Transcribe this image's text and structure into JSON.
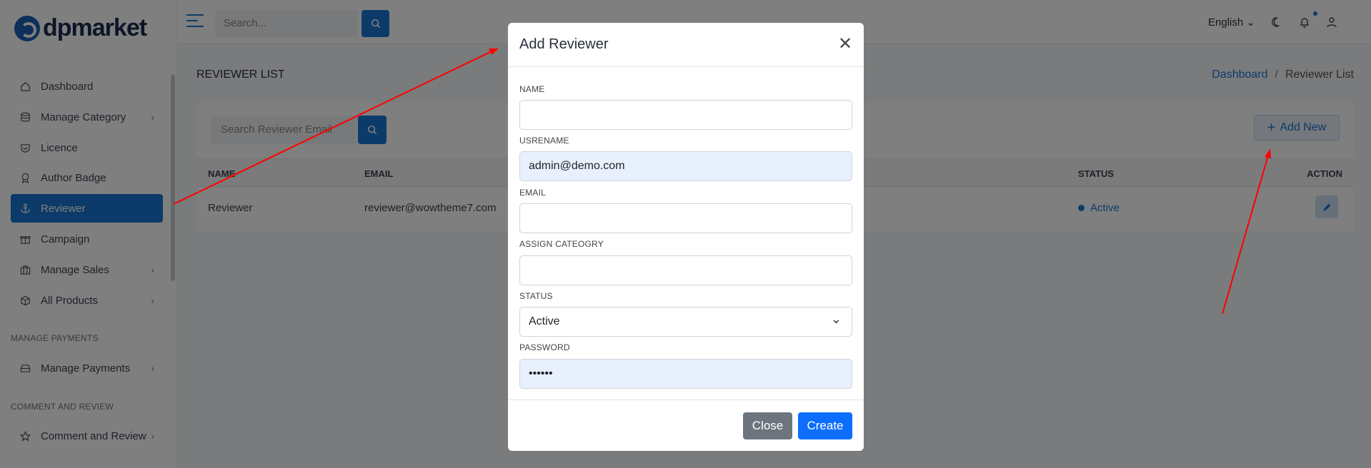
{
  "app": {
    "logo_text": "dpmarket"
  },
  "sidebar": {
    "items": [
      {
        "label": "Dashboard",
        "icon": "home-icon"
      },
      {
        "label": "Manage Category",
        "icon": "database-icon",
        "chevron": true
      },
      {
        "label": "Licence",
        "icon": "shield-icon"
      },
      {
        "label": "Author Badge",
        "icon": "award-icon"
      },
      {
        "label": "Reviewer",
        "icon": "anchor-icon",
        "active": true
      },
      {
        "label": "Campaign",
        "icon": "gift-icon"
      },
      {
        "label": "Manage Sales",
        "icon": "briefcase-icon",
        "chevron": true
      },
      {
        "label": "All Products",
        "icon": "box-icon",
        "chevron": true
      }
    ],
    "sections": [
      {
        "title": "MANAGE PAYMENTS",
        "items": [
          {
            "label": "Manage Payments",
            "icon": "card-icon",
            "chevron": true
          }
        ]
      },
      {
        "title": "COMMENT AND REVIEW",
        "items": [
          {
            "label": "Comment and Review",
            "icon": "star-icon",
            "chevron": true
          }
        ]
      }
    ]
  },
  "topbar": {
    "search_placeholder": "Search...",
    "language": "English"
  },
  "page": {
    "title": "REVIEWER LIST",
    "breadcrumb": [
      "Dashboard",
      "Reviewer List"
    ],
    "search_placeholder": "Search Reviewer Email",
    "add_new_label": "Add New",
    "table": {
      "headers": {
        "name": "NAME",
        "email": "EMAIL",
        "status": "STATUS",
        "action": "ACTION"
      },
      "rows": [
        {
          "name": "Reviewer",
          "email": "reviewer@wowtheme7.com",
          "status": "Active"
        }
      ]
    }
  },
  "modal": {
    "title": "Add Reviewer",
    "fields": {
      "name_label": "NAME",
      "name_value": "",
      "username_label": "USRENAME",
      "username_value": "admin@demo.com",
      "email_label": "EMAIL",
      "email_value": "",
      "category_label": "ASSIGN CATEOGRY",
      "category_value": "",
      "status_label": "STATUS",
      "status_value": "Active",
      "password_label": "PASSWORD",
      "password_value": "••••••"
    },
    "close_label": "Close",
    "create_label": "Create"
  },
  "colors": {
    "primary": "#1976d2",
    "create": "#0d6efd",
    "secondary": "#6c757d",
    "annotation": "#ff0000"
  }
}
